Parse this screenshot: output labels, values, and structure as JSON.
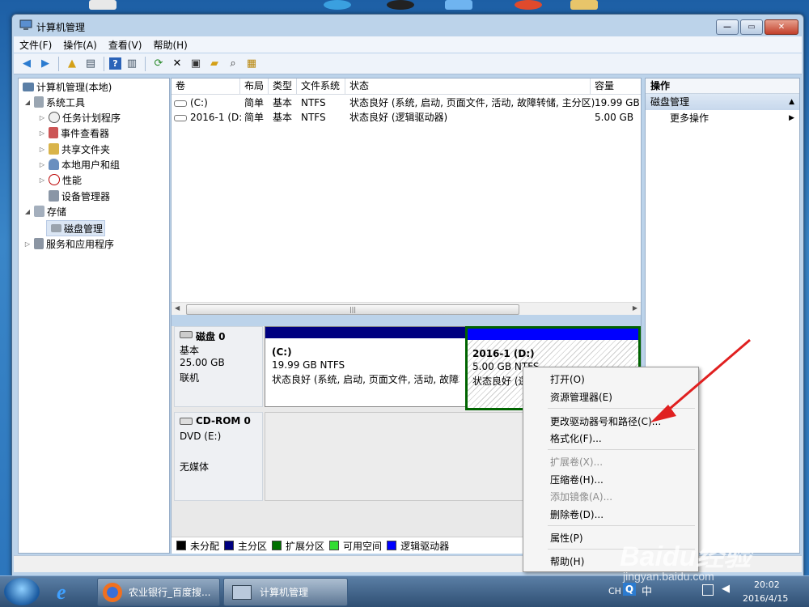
{
  "window": {
    "title": "计算机管理"
  },
  "menu": [
    "文件(F)",
    "操作(A)",
    "查看(V)",
    "帮助(H)"
  ],
  "tree": {
    "root": "计算机管理(本地)",
    "system_tools": "系统工具",
    "task_scheduler": "任务计划程序",
    "event_viewer": "事件查看器",
    "shared_folders": "共享文件夹",
    "local_users": "本地用户和组",
    "performance": "性能",
    "device_manager": "设备管理器",
    "storage": "存储",
    "disk_management": "磁盘管理",
    "services_apps": "服务和应用程序"
  },
  "volumes": {
    "headers": [
      "卷",
      "布局",
      "类型",
      "文件系统",
      "状态",
      "容量"
    ],
    "rows": [
      [
        "(C:)",
        "简单",
        "基本",
        "NTFS",
        "状态良好 (系统, 启动, 页面文件, 活动, 故障转储, 主分区)",
        "19.99 GB"
      ],
      [
        "2016-1 (D:)",
        "简单",
        "基本",
        "NTFS",
        "状态良好 (逻辑驱动器)",
        "5.00 GB"
      ]
    ]
  },
  "disk0": {
    "name": "磁盘 0",
    "type": "基本",
    "size": "25.00 GB",
    "status": "联机",
    "c_title": "(C:)",
    "c_size": "19.99 GB NTFS",
    "c_status": "状态良好 (系统, 启动, 页面文件, 活动, 故障转",
    "d_title": "2016-1  (D:)",
    "d_size": "5.00 GB NTFS",
    "d_status": "状态良好 (逻"
  },
  "cdrom": {
    "name": "CD-ROM 0",
    "drive": "DVD (E:)",
    "media": "无媒体"
  },
  "legend": [
    {
      "label": "未分配",
      "color": "#000000"
    },
    {
      "label": "主分区",
      "color": "#000080"
    },
    {
      "label": "扩展分区",
      "color": "#007000"
    },
    {
      "label": "可用空间",
      "color": "#33dd33"
    },
    {
      "label": "逻辑驱动器",
      "color": "#0000ff"
    }
  ],
  "actions": {
    "header": "操作",
    "section": "磁盘管理",
    "more": "更多操作"
  },
  "context_menu": {
    "open": "打开(O)",
    "explorer": "资源管理器(E)",
    "change_letter": "更改驱动器号和路径(C)...",
    "format": "格式化(F)...",
    "extend": "扩展卷(X)...",
    "shrink": "压缩卷(H)...",
    "add_mirror": "添加镜像(A)...",
    "delete": "删除卷(D)...",
    "properties": "属性(P)",
    "help": "帮助(H)"
  },
  "taskbar": {
    "firefox_label": "农业银行_百度搜...",
    "mgmt_label": "计算机管理",
    "lang": "CH",
    "time": "20:02",
    "date": "2016/4/15"
  },
  "watermark": {
    "brand": "Baidu经验",
    "url": "jingyan.baidu.com"
  },
  "colors": {
    "annotation_arrow": "#e02020",
    "selection_border": "#006400"
  }
}
